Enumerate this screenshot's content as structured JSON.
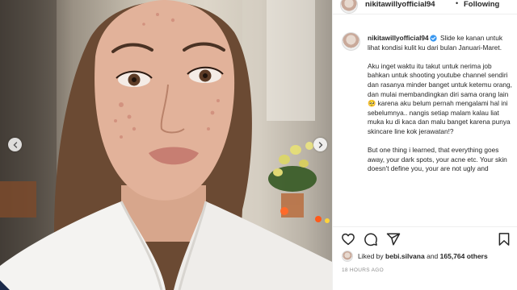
{
  "header": {
    "username": "nikitawillyofficial94",
    "separator": "•",
    "follow_status": "Following"
  },
  "caption": {
    "username": "nikitawillyofficial94",
    "paragraphs": [
      "Slide ke kanan untuk lihat kondisi kulit ku dari bulan Januari-Maret.",
      "Aku inget waktu itu takut untuk nerima job bahkan untuk shooting youtube channel sendiri dan rasanya minder banget untuk ketemu orang, dan mulai membandingkan diri sama orang lain 🥺 karena aku belum pernah mengalami hal ini sebelumnya.. nangis setiap malam kalau liat muka ku di kaca dan malu banget karena punya skincare line kok jerawatan!?",
      "But one thing i learned, that everything goes away, your dark spots, your acne etc. Your skin doesn't define you, your are not ugly and"
    ]
  },
  "likes": {
    "prefix": "Liked by",
    "user": "bebi.silvana",
    "middle": "and",
    "count": "165,764 others"
  },
  "timestamp": "18 HOURS AGO",
  "icons": {
    "prev": "chevron-left-icon",
    "next": "chevron-right-icon",
    "verified": "verified-badge-icon",
    "like": "heart-icon",
    "comment": "comment-icon",
    "share": "send-icon",
    "save": "bookmark-icon"
  },
  "colors": {
    "text": "#262626",
    "muted": "#8e8e8e",
    "verified": "#3897f0",
    "border": "#efefef"
  }
}
